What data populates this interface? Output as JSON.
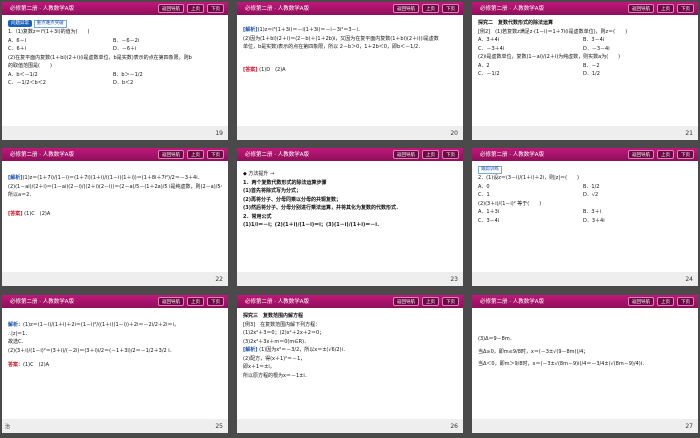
{
  "header": {
    "title": "必修第二册 · 人教数学A版",
    "btn_nav": "返回导航",
    "btn_prev": "上页",
    "btn_next": "下页"
  },
  "footer_left": "治",
  "slides": [
    {
      "page": "19",
      "lines": {
        "title_a": "问题异常",
        "title_b": "重点难点突破",
        "q1": "1.（1)复数z＝i³(1＋3i)的值为(　　)",
        "q1_a": "A．6－i",
        "q1_b": "B．－6－2i",
        "q1_c": "C．6＋i",
        "q1_d": "D．－6＋i",
        "q2": "(2)在复平面内复数(1＋bi)(2＋i)(i是虚数单位，b是实数)表示的点在第四象限，则b",
        "q2b": "的取值范围是(　　)",
        "q2_a": "A．b＜－1/2",
        "q2_b": "B．b＞－1/2",
        "q2_c": "C．－1/2＜b＜2",
        "q2_d": "D．b＜2"
      }
    },
    {
      "page": "20",
      "lines": {
        "l1_tag": "[解析]",
        "l1": "(1)z＝i³(1＋3i)＝－i(1＋3i)＝－i－3i²＝3－i．",
        "l2": "(2)因为(1＋bi)(2＋i)＝(2－b)＋(1＋2b)i，又因为在复平面内复数(1＋bi)(2＋i)(i是虚数",
        "l3": "单位，b是实数)表示的点在第四象限，所以 2－b＞0，1＋2b＜0，即b＜－1/2．",
        "ans_tag": "[答案]",
        "ans": "(1)D　(2)A"
      }
    },
    {
      "page": "21",
      "lines": {
        "h": "探究二　复数代数形式的除法运算",
        "e1": "[例2]　(1)若复数z满足z·(1－i)＝1＋7i(i是虚数单位)，则z＝(　　)",
        "e1_a": "A．3＋4i",
        "e1_b": "B．3－4i",
        "e1_c": "C．－3＋4i",
        "e1_d": "D．－3－4i",
        "e2": "(2)i是虚数单位，复数(1－ai)/(2＋i)为纯虚数，则实数a为(　　)",
        "e2_a": "A．2",
        "e2_b": "B．－2",
        "e2_c": "C．－1/2",
        "e2_d": "D．1/2"
      }
    },
    {
      "page": "22",
      "lines": {
        "l1_tag": "[解析]",
        "l1": "(1)z＝(1＋7i)/(1－i)＝(1＋7i)(1＋i)/((1－i)(1＋i))＝(1＋8i＋7i²)/2＝－3＋4i．",
        "l2": "(2)(1－ai)/(2＋i)＝(1－ai)(2－i)/((2＋i)(2－i))＝(2－a)/5－(1＋2a)/5 i是纯虚数，则(2－a)/5＝0，",
        "l3": "所以a＝2．",
        "ans_tag": "[答案]",
        "ans": "(1)C　(2)A"
      }
    },
    {
      "page": "23",
      "lines": {
        "h": "◆ 方法提升 →",
        "m1": "1．两个复数代数形式的除法运算步骤",
        "m2": "(1)首先将除式写为分式；",
        "m3": "(2)再将分子、分母同乘以分母的共轭复数；",
        "m4": "(3)然后将分子、分母分别进行乘法运算，并将其化为复数的代数形式．",
        "m5": "2．常用公式",
        "m6": "(1)1/i＝－i；(2)(1＋i)/(1－i)＝i；(3)(1－i)/(1＋i)＝－i．"
      }
    },
    {
      "page": "24",
      "lines": {
        "h_tag": "跟踪训练",
        "q1": "2．(1)设z＝(3－i)/(1＋i)＋2i，则|z|＝(　　)",
        "q1_a": "A．0",
        "q1_b": "B．1/2",
        "q1_c": "C．1",
        "q1_d": "D．√2",
        "q2": "(2)(3＋i)/(1－i)² 等于(　　)",
        "q2_a": "A．1＋3i",
        "q2_b": "B．3＋i",
        "q2_c": "C．3－4i",
        "q2_d": "D．3＋4i"
      }
    },
    {
      "page": "25",
      "lines": {
        "l1_tag": "解析：",
        "l1": "(1)z＝(1－i)/(1＋i)＋2i＝(1－i)²/((1＋i)(1－i))＋2i＝－2i/2＋2i＝i，",
        "l2": "∴|z|＝1．",
        "l3": "故选C．",
        "l4": "(2)(3＋i)/(1－i)²＝(3＋i)/(－2i)＝(3＋i)i/2＝(－1＋3i)/2＝－1/2＋3/2 i．",
        "ans_tag": "答案：",
        "ans": "(1)C　(2)A"
      }
    },
    {
      "page": "26",
      "lines": {
        "h": "探究三　复数范围内解方程",
        "e1": "[例3]　在复数范围内解下列方程：",
        "e2": "(1)2x²＋3＝0；(2)x²＋2x＋2＝0；",
        "e3": "(3)2x²＋3x＋m＝0(m∈R)．",
        "s1_tag": "[解析]",
        "s1": "(1)因为x²＝－3/2，所以x＝±(√6/2)i．",
        "s2": "(2)配方，得(x＋1)²＝－1，",
        "s3": "即x＋1＝±i，",
        "s4": "所以原方程的根为x＝－1±i．"
      }
    },
    {
      "page": "27",
      "lines": {
        "l1": "(3)Δ＝9－8m．",
        "l2": "当Δ≥0，即m≤9/8时，x＝(－3±√(9－8m))/4；",
        "l3": "当Δ＜0，即m＞9/8时，x＝(－3±√(8m－9)i)/4＝－3/4±(√(8m－9)/4)i．"
      }
    }
  ]
}
